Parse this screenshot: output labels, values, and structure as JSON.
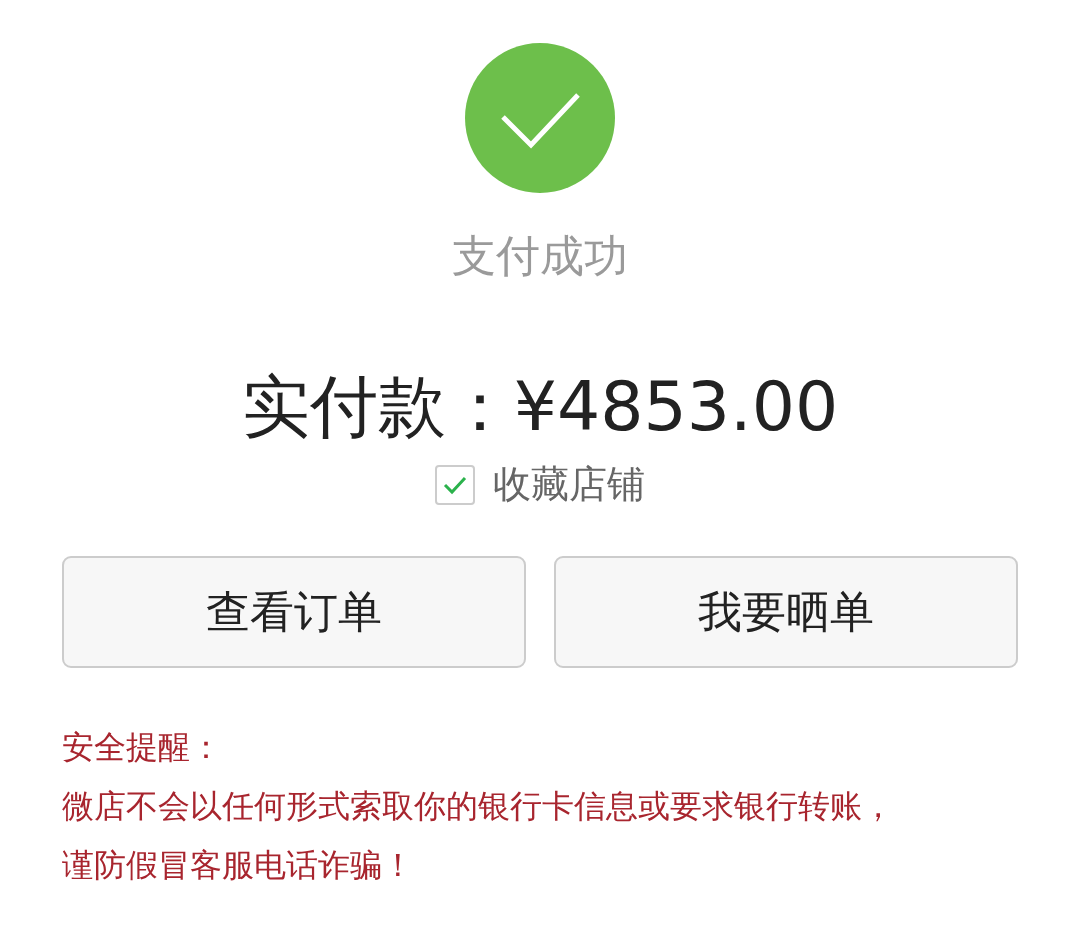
{
  "status": {
    "title": "支付成功"
  },
  "amount": {
    "text": "实付款：¥4853.00"
  },
  "favorite": {
    "label": "收藏店铺",
    "checked": true
  },
  "buttons": [
    "查看订单",
    "我要晒单"
  ],
  "notice": {
    "title": "安全提醒：",
    "lines": [
      "微店不会以任何形式索取你的银行卡信息或要求银行转账，",
      "谨防假冒客服电话诈骗！"
    ]
  }
}
